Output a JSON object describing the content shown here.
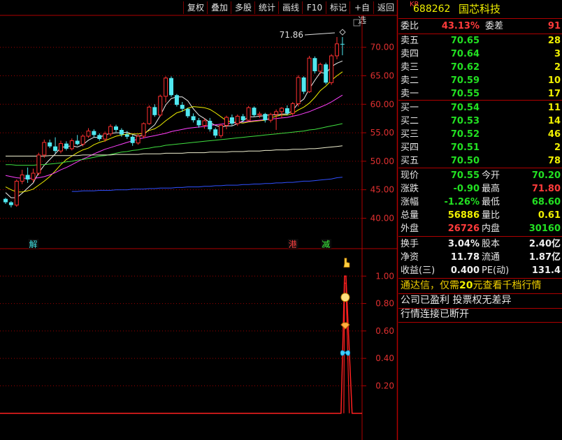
{
  "toolbar": {
    "buttons": [
      "复权",
      "叠加",
      "多股",
      "统计",
      "画线",
      "F10",
      "标记",
      "+自选",
      "返回"
    ]
  },
  "stock": {
    "market": "KR",
    "code": "688262",
    "name": "国芯科技"
  },
  "quote": {
    "weibi_label": "委比",
    "weibi": "43.13%",
    "weicha_label": "委差",
    "weicha": "91",
    "asks": [
      {
        "label": "卖五",
        "price": "70.65",
        "vol": "28"
      },
      {
        "label": "卖四",
        "price": "70.64",
        "vol": "3"
      },
      {
        "label": "卖三",
        "price": "70.62",
        "vol": "2"
      },
      {
        "label": "卖二",
        "price": "70.59",
        "vol": "10"
      },
      {
        "label": "卖一",
        "price": "70.55",
        "vol": "17"
      }
    ],
    "bids": [
      {
        "label": "买一",
        "price": "70.54",
        "vol": "11"
      },
      {
        "label": "买二",
        "price": "70.53",
        "vol": "14"
      },
      {
        "label": "买三",
        "price": "70.52",
        "vol": "46"
      },
      {
        "label": "买四",
        "price": "70.51",
        "vol": "2"
      },
      {
        "label": "买五",
        "price": "70.50",
        "vol": "78"
      }
    ],
    "stats": [
      {
        "l1": "现价",
        "v1": "70.55",
        "c1": "green",
        "l2": "今开",
        "v2": "70.20",
        "c2": "green"
      },
      {
        "l1": "涨跌",
        "v1": "-0.90",
        "c1": "green",
        "l2": "最高",
        "v2": "71.80",
        "c2": "red"
      },
      {
        "l1": "涨幅",
        "v1": "-1.26%",
        "c1": "green",
        "l2": "最低",
        "v2": "68.60",
        "c2": "green"
      },
      {
        "l1": "总量",
        "v1": "56886",
        "c1": "yellow",
        "l2": "量比",
        "v2": "0.61",
        "c2": "yellow"
      },
      {
        "l1": "外盘",
        "v1": "26726",
        "c1": "red",
        "l2": "内盘",
        "v2": "30160",
        "c2": "green"
      }
    ],
    "fin": [
      {
        "l1": "换手",
        "v1": "3.04%",
        "l2": "股本",
        "v2": "2.40亿"
      },
      {
        "l1": "净资",
        "v1": "11.78",
        "l2": "流通",
        "v2": "1.87亿"
      },
      {
        "l1": "收益(三)",
        "v1": "0.400",
        "l2": "PE(动)",
        "v2": "131.4"
      }
    ],
    "notice": {
      "pre": "通达信，仅需",
      "num": "20",
      "post": "元查看千档行情"
    },
    "info1": "公司已盈利  投票权无差异",
    "info2": "行情连接已断开"
  },
  "chart_data": [
    {
      "type": "candlestick",
      "title": "",
      "y_ticks": [
        "70.00",
        "65.00",
        "60.00",
        "55.00",
        "50.00",
        "45.00",
        "40.00"
      ],
      "ylim": [
        36.5,
        74.5
      ],
      "max_label": "71.86",
      "markers": [
        {
          "text": "解",
          "color": "#40e0e0",
          "index": 5
        },
        {
          "text": "港",
          "color": "#ff4040",
          "index": 52
        },
        {
          "text": "减",
          "color": "#40ff40",
          "index": 58
        }
      ],
      "candles": [
        [
          43.4,
          43.6,
          42.5,
          42.8
        ],
        [
          42.8,
          43.0,
          41.9,
          42.3
        ],
        [
          42.3,
          46.8,
          42.0,
          46.5
        ],
        [
          46.5,
          48.5,
          46.0,
          47.6
        ],
        [
          47.6,
          48.9,
          46.2,
          46.8
        ],
        [
          46.8,
          48.7,
          46.3,
          47.9
        ],
        [
          47.9,
          51.5,
          47.5,
          51.1
        ],
        [
          51.1,
          53.8,
          50.6,
          53.3
        ],
        [
          53.3,
          53.8,
          52.3,
          52.6
        ],
        [
          52.6,
          54.2,
          51.4,
          51.8
        ],
        [
          51.8,
          53.6,
          51.4,
          53.1
        ],
        [
          53.1,
          53.5,
          51.9,
          52.2
        ],
        [
          52.2,
          54.0,
          51.9,
          53.6
        ],
        [
          53.6,
          54.6,
          52.8,
          53.0
        ],
        [
          53.0,
          54.7,
          52.6,
          54.4
        ],
        [
          54.4,
          55.8,
          54.1,
          55.3
        ],
        [
          55.3,
          55.6,
          54.2,
          54.6
        ],
        [
          54.6,
          54.9,
          53.6,
          53.9
        ],
        [
          53.9,
          55.2,
          53.4,
          54.8
        ],
        [
          54.8,
          56.5,
          54.4,
          56.1
        ],
        [
          56.1,
          56.4,
          55.1,
          55.5
        ],
        [
          55.5,
          55.8,
          54.3,
          54.7
        ],
        [
          54.7,
          55.3,
          53.9,
          54.3
        ],
        [
          54.3,
          54.6,
          52.7,
          53.2
        ],
        [
          53.2,
          54.8,
          52.9,
          54.4
        ],
        [
          54.4,
          56.8,
          54.0,
          56.6
        ],
        [
          56.6,
          59.8,
          56.4,
          59.5
        ],
        [
          59.5,
          60.0,
          57.8,
          58.1
        ],
        [
          58.1,
          61.7,
          57.8,
          61.4
        ],
        [
          61.4,
          64.9,
          60.3,
          64.6
        ],
        [
          64.6,
          64.9,
          61.3,
          61.6
        ],
        [
          61.6,
          61.8,
          59.6,
          59.9
        ],
        [
          59.9,
          60.4,
          58.7,
          59.2
        ],
        [
          59.2,
          59.4,
          57.6,
          57.9
        ],
        [
          57.9,
          58.4,
          56.8,
          57.2
        ],
        [
          57.2,
          57.6,
          55.9,
          56.3
        ],
        [
          56.3,
          57.5,
          55.7,
          57.1
        ],
        [
          57.1,
          57.6,
          55.2,
          55.6
        ],
        [
          55.6,
          55.9,
          54.1,
          54.5
        ],
        [
          54.5,
          56.6,
          54.1,
          56.3
        ],
        [
          56.3,
          58.0,
          55.6,
          57.7
        ],
        [
          57.7,
          58.2,
          56.3,
          56.6
        ],
        [
          56.6,
          58.2,
          56.2,
          57.9
        ],
        [
          57.9,
          58.3,
          56.8,
          57.2
        ],
        [
          57.2,
          59.7,
          57.1,
          59.4
        ],
        [
          59.4,
          59.6,
          57.8,
          58.1
        ],
        [
          58.1,
          58.7,
          57.6,
          58.3
        ],
        [
          58.3,
          58.5,
          56.8,
          57.2
        ],
        [
          57.2,
          58.5,
          56.8,
          58.2
        ],
        [
          58.2,
          59.1,
          55.5,
          58.7
        ],
        [
          58.7,
          59.5,
          57.6,
          59.3
        ],
        [
          59.3,
          59.8,
          58.1,
          58.4
        ],
        [
          58.4,
          60.4,
          58.0,
          60.1
        ],
        [
          60.1,
          65.1,
          59.6,
          64.7
        ],
        [
          64.7,
          64.9,
          61.8,
          62.2
        ],
        [
          62.2,
          68.5,
          62.0,
          68.1
        ],
        [
          68.1,
          68.4,
          65.4,
          65.8
        ],
        [
          65.8,
          67.3,
          65.3,
          67.0
        ],
        [
          67.0,
          67.3,
          63.5,
          63.8
        ],
        [
          63.8,
          68.8,
          63.4,
          68.5
        ],
        [
          68.5,
          71.8,
          67.9,
          70.6
        ],
        [
          70.6,
          71.8,
          68.6,
          70.55
        ]
      ],
      "ma": [
        {
          "name": "MA5",
          "color": "#f0f0f0",
          "values": [
            44.5,
            43.6,
            43.6,
            44.4,
            45.3,
            46.2,
            48.0,
            49.3,
            50.3,
            51.3,
            52.4,
            52.6,
            52.7,
            52.5,
            52.9,
            53.7,
            54.2,
            54.2,
            54.6,
            54.9,
            55.0,
            55.0,
            55.1,
            54.7,
            54.4,
            54.6,
            55.6,
            56.4,
            58.0,
            59.9,
            61.0,
            61.3,
            61.3,
            60.6,
            59.2,
            58.1,
            57.5,
            56.8,
            56.3,
            56.0,
            56.2,
            56.2,
            56.6,
            57.1,
            57.8,
            57.8,
            57.9,
            58.0,
            58.2,
            58.1,
            58.3,
            58.3,
            58.9,
            60.2,
            60.9,
            62.7,
            64.2,
            65.6,
            65.4,
            66.6,
            67.2,
            67.6
          ]
        },
        {
          "name": "MA10",
          "color": "#f0f000",
          "values": [
            45.5,
            45.0,
            44.6,
            44.6,
            44.8,
            45.1,
            45.8,
            46.5,
            47.3,
            48.3,
            49.4,
            50.3,
            50.9,
            51.5,
            52.0,
            52.3,
            52.9,
            53.3,
            53.6,
            54.0,
            54.4,
            54.6,
            54.8,
            54.8,
            54.8,
            54.9,
            55.4,
            55.7,
            56.3,
            57.1,
            57.8,
            58.5,
            58.8,
            59.3,
            59.6,
            59.5,
            59.4,
            59.1,
            58.5,
            57.8,
            57.1,
            56.9,
            56.8,
            56.7,
            56.9,
            57.0,
            57.1,
            57.2,
            57.6,
            57.9,
            58.1,
            58.1,
            58.4,
            59.0,
            59.5,
            60.2,
            61.2,
            62.4,
            63.2,
            64.2,
            65.0,
            65.7
          ]
        },
        {
          "name": "MA20",
          "color": "#ff40ff",
          "values": [
            47.5,
            47.3,
            47.1,
            47.0,
            47.0,
            47.0,
            47.1,
            47.3,
            47.6,
            48.0,
            48.5,
            48.9,
            49.4,
            49.9,
            50.4,
            50.8,
            51.3,
            51.7,
            52.1,
            52.4,
            52.7,
            53.0,
            53.3,
            53.6,
            53.9,
            54.1,
            54.3,
            54.5,
            54.7,
            54.9,
            55.2,
            55.4,
            55.6,
            55.8,
            55.9,
            56.0,
            56.1,
            56.3,
            56.4,
            56.5,
            56.6,
            56.7,
            56.8,
            56.9,
            57.0,
            57.1,
            57.2,
            57.3,
            57.4,
            57.5,
            57.6,
            57.7,
            57.9,
            58.1,
            58.4,
            58.7,
            59.1,
            59.5,
            59.9,
            60.4,
            61.0,
            61.6
          ]
        },
        {
          "name": "MA30",
          "color": "#40e040",
          "values": [
            49.4,
            49.4,
            49.3,
            49.3,
            49.3,
            49.3,
            49.4,
            49.4,
            49.5,
            49.6,
            49.7,
            49.9,
            50.0,
            50.2,
            50.3,
            50.5,
            50.7,
            50.9,
            51.0,
            51.2,
            51.4,
            51.6,
            51.7,
            51.9,
            52.0,
            52.2,
            52.3,
            52.5,
            52.6,
            52.8,
            52.9,
            53.0,
            53.1,
            53.2,
            53.3,
            53.4,
            53.5,
            53.6,
            53.7,
            53.8,
            53.9,
            54.0,
            54.1,
            54.2,
            54.3,
            54.4,
            54.5,
            54.6,
            54.7,
            54.8,
            54.9,
            55.0,
            55.1,
            55.2,
            55.3,
            55.5,
            55.6,
            55.8,
            56.0,
            56.2,
            56.4,
            56.6
          ]
        },
        {
          "name": "MA60",
          "color": "#f0f0d0",
          "values": [
            50.9,
            50.9,
            50.9,
            50.9,
            50.9,
            50.9,
            50.9,
            50.9,
            51.0,
            51.0,
            51.0,
            51.0,
            51.0,
            51.0,
            51.1,
            51.1,
            51.1,
            51.1,
            51.1,
            51.1,
            51.2,
            51.2,
            51.2,
            51.2,
            51.2,
            51.3,
            51.3,
            51.3,
            51.3,
            51.4,
            51.4,
            51.4,
            51.4,
            51.5,
            51.5,
            51.5,
            51.5,
            51.6,
            51.6,
            51.6,
            51.6,
            51.7,
            51.7,
            51.7,
            51.8,
            51.8,
            51.8,
            51.9,
            51.9,
            52.0,
            52.0,
            52.0,
            52.1,
            52.1,
            52.1,
            52.2,
            52.2,
            52.3,
            52.4,
            52.5,
            52.6,
            52.7
          ]
        },
        {
          "name": "MA120",
          "color": "#3050ff",
          "values": [
            null,
            null,
            null,
            null,
            null,
            null,
            null,
            null,
            null,
            null,
            null,
            null,
            44.7,
            44.7,
            44.8,
            44.8,
            44.8,
            44.9,
            44.9,
            44.9,
            45.0,
            45.0,
            45.0,
            45.1,
            45.1,
            45.1,
            45.2,
            45.2,
            45.3,
            45.3,
            45.3,
            45.4,
            45.4,
            45.5,
            45.5,
            45.5,
            45.6,
            45.6,
            45.7,
            45.7,
            45.8,
            45.8,
            45.8,
            45.9,
            45.9,
            46.0,
            46.0,
            46.1,
            46.1,
            46.2,
            46.2,
            46.3,
            46.3,
            46.4,
            46.5,
            46.5,
            46.6,
            46.7,
            46.8,
            46.9,
            47.1,
            47.2
          ]
        }
      ]
    },
    {
      "type": "line",
      "title": "",
      "y_ticks": [
        "1.00",
        "0.80",
        "0.60",
        "0.40",
        "0.20"
      ],
      "ylim": [
        -0.195,
        1.195
      ],
      "color": "#ff2020",
      "signal_start_index": 61,
      "signal_end_index": 63,
      "icons": [
        "pointer-hand-icon",
        "money-bag-icon",
        "diamond-icon",
        "butterfly-icon"
      ]
    }
  ]
}
